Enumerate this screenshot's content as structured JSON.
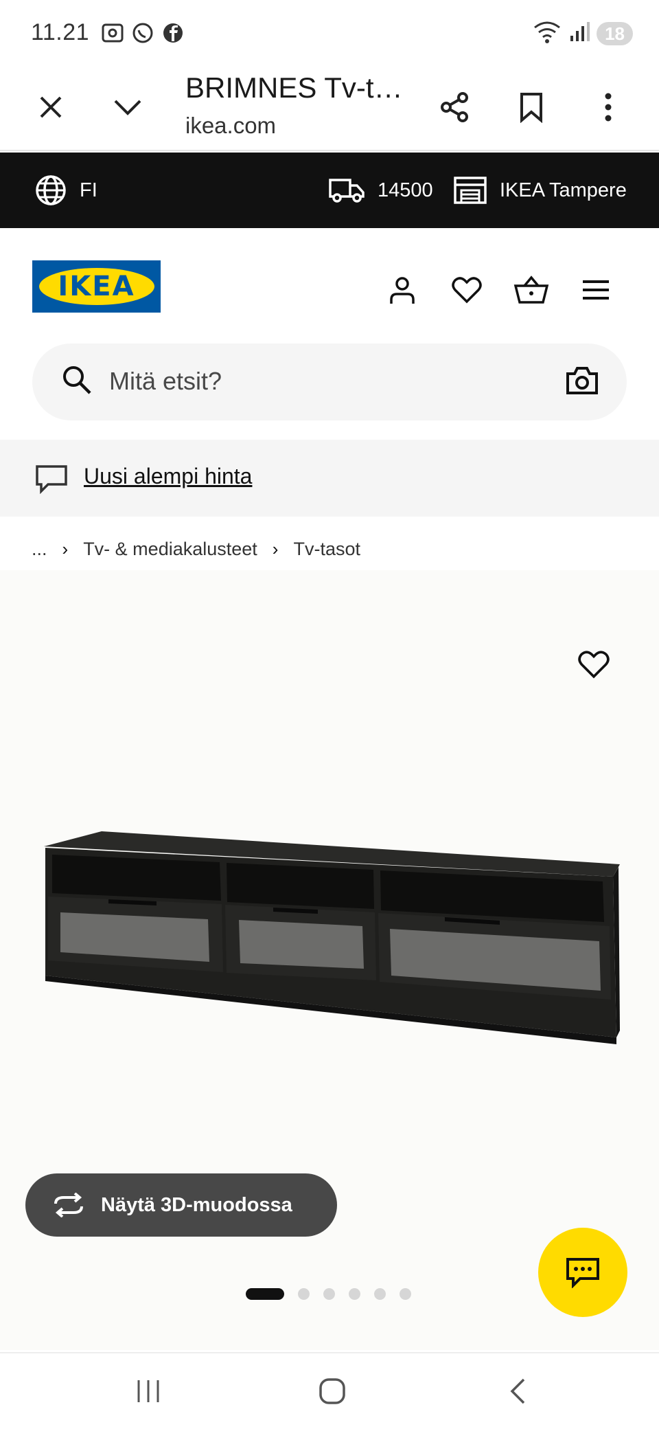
{
  "status_bar": {
    "time": "11.21",
    "battery": "18",
    "left_icons": [
      "screenshot-icon",
      "whatsapp-icon",
      "facebook-icon"
    ],
    "right_icons": [
      "wifi-icon",
      "signal-icon"
    ]
  },
  "browser": {
    "title": "BRIMNES Tv-t…",
    "url": "ikea.com",
    "buttons": [
      "close-icon",
      "chevron-down-icon",
      "share-icon",
      "bookmark-icon",
      "more-icon"
    ]
  },
  "topbar": {
    "language": "FI",
    "postal_code": "14500",
    "store": "IKEA Tampere"
  },
  "header": {
    "logo_text": "IKEA",
    "logo_colors": {
      "blue": "#0058a3",
      "yellow": "#ffdb00"
    }
  },
  "search": {
    "placeholder": "Mitä etsit?"
  },
  "promo": {
    "link_text": "Uusi alempi hinta"
  },
  "breadcrumb": {
    "items": [
      "...",
      "Tv- & mediakalusteet",
      "Tv-tasot"
    ]
  },
  "product": {
    "view_3d_label": "Näytä 3D-muodossa",
    "carousel": {
      "total": 6,
      "active_index": 1
    }
  },
  "colors": {
    "black_bar": "#111111",
    "accent_yellow": "#ffdb00",
    "button_dark": "#484848"
  }
}
